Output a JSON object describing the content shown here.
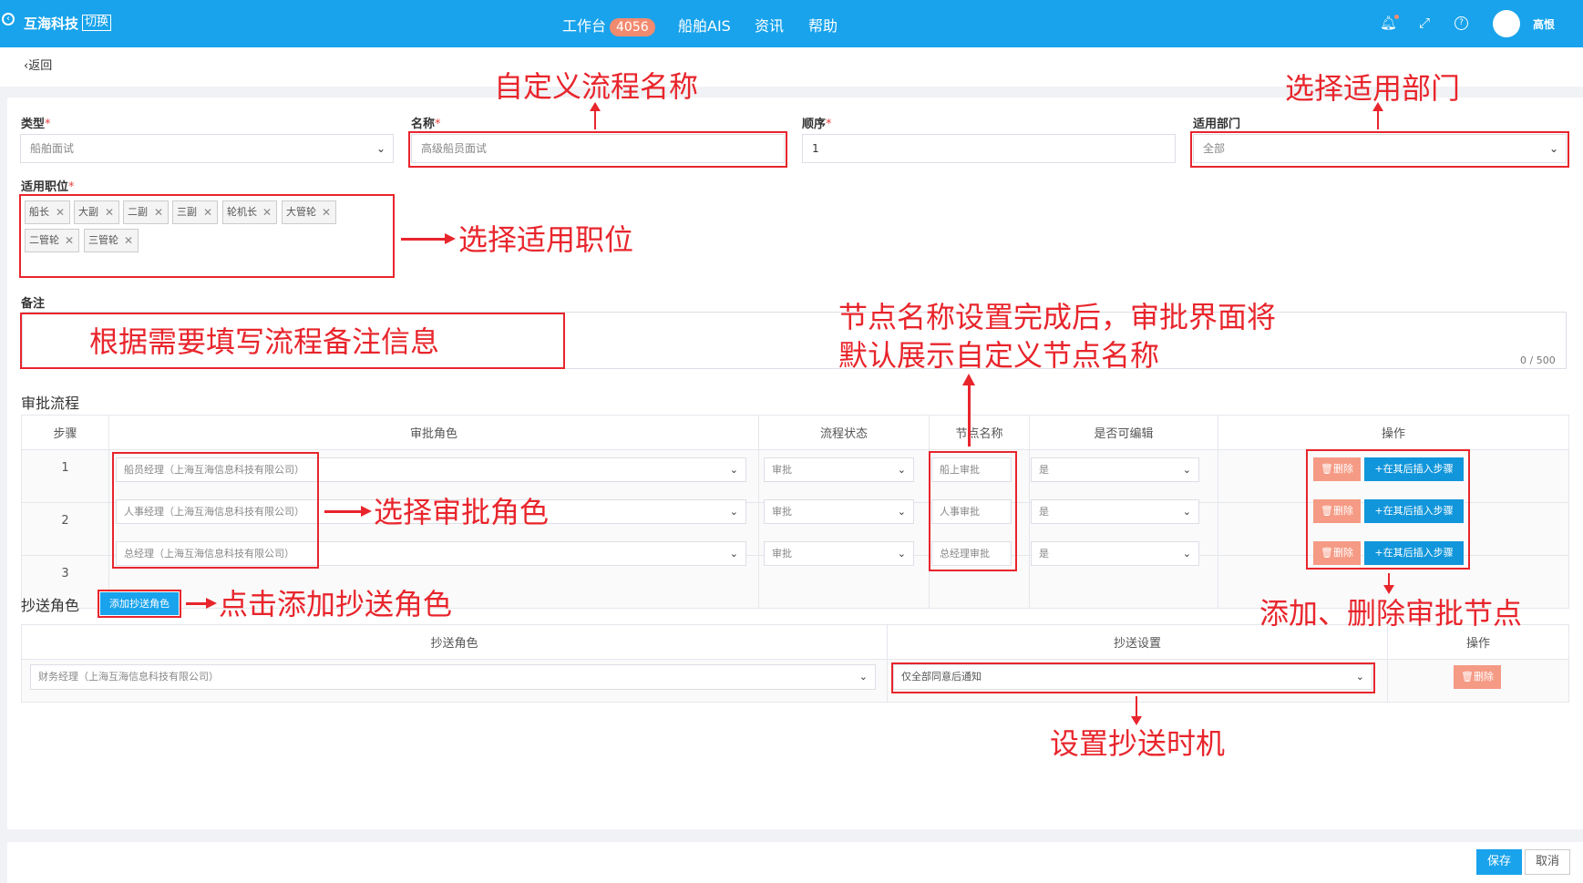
{
  "topbar": {
    "logo": "互海科技",
    "switch_label": "切换",
    "nav": [
      {
        "label": "工作台",
        "badge": "4056"
      },
      {
        "label": "船舶AIS"
      },
      {
        "label": "资讯"
      },
      {
        "label": "帮助"
      }
    ],
    "username": "高恨"
  },
  "back_label": "返回",
  "form": {
    "type_label": "类型",
    "type_value": "船舶面试",
    "name_label": "名称",
    "name_value": "高级船员面试",
    "order_label": "顺序",
    "order_value": "1",
    "dept_label": "适用部门",
    "dept_value": "全部",
    "positions_label": "适用职位",
    "positions": [
      "船长",
      "大副",
      "二副",
      "三副",
      "轮机长",
      "大管轮",
      "二管轮",
      "三管轮"
    ],
    "remark_label": "备注",
    "remark_counter": "0 / 500",
    "required_mark": "*"
  },
  "approval": {
    "section_title": "审批流程",
    "headers": [
      "步骤",
      "审批角色",
      "流程状态",
      "节点名称",
      "是否可编辑",
      "操作"
    ],
    "rows": [
      {
        "step": "1",
        "role": "船员经理（上海互海信息科技有限公司）",
        "status": "审批",
        "node": "船上审批",
        "editable": "是"
      },
      {
        "step": "2",
        "role": "人事经理（上海互海信息科技有限公司）",
        "status": "审批",
        "node": "人事审批",
        "editable": "是"
      },
      {
        "step": "3",
        "role": "总经理（上海互海信息科技有限公司）",
        "status": "审批",
        "node": "总经理审批",
        "editable": "是"
      }
    ],
    "delete_label": "删除",
    "insert_label": "在其后插入步骤"
  },
  "cc": {
    "section_title": "抄送角色",
    "add_button": "添加抄送角色",
    "headers": [
      "抄送角色",
      "抄送设置",
      "操作"
    ],
    "row": {
      "role": "财务经理（上海互海信息科技有限公司）",
      "setting": "仅全部同意后通知"
    },
    "delete_label": "删除"
  },
  "footer": {
    "save": "保存",
    "cancel": "取消"
  },
  "annotations": {
    "name": "自定义流程名称",
    "dept": "选择适用部门",
    "position": "选择适用职位",
    "remark": "根据需要填写流程备注信息",
    "node_line1": "节点名称设置完成后，审批界面将",
    "node_line2": "默认展示自定义节点名称",
    "role": "选择审批角色",
    "add_cc": "点击添加抄送角色",
    "add_delete": "添加、删除审批节点",
    "cc_timing": "设置抄送时机"
  },
  "colors": {
    "primary": "#18a3ec",
    "annotation_red": "#e8252c",
    "delete_btn": "#f59a84",
    "insert_btn": "#1296db"
  }
}
